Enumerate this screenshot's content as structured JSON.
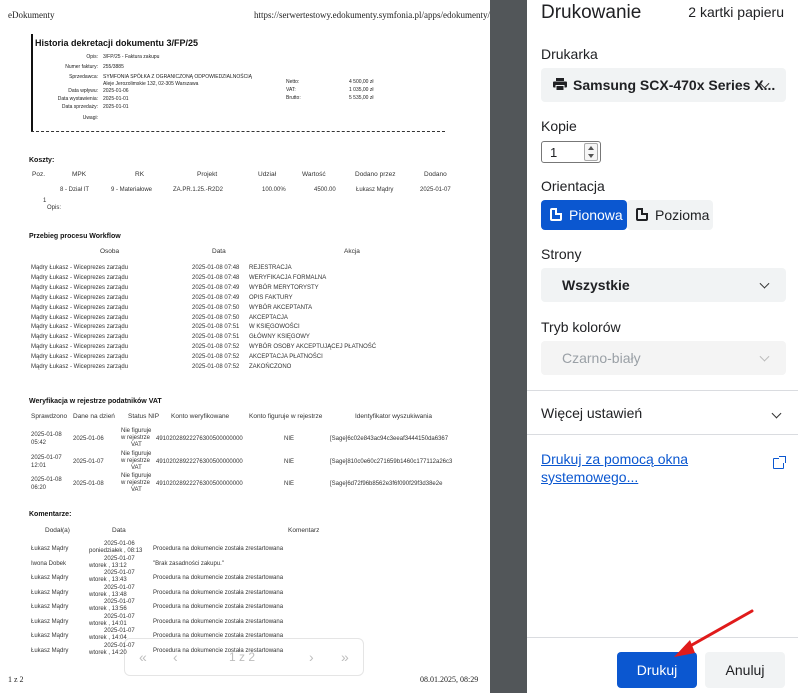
{
  "page_header": {
    "left": "eDokumenty",
    "right": "https://serwertestowy.edokumenty.symfonia.pl/apps/edokumenty/e..."
  },
  "page_footer": {
    "left": "1 z 2",
    "right": "08.01.2025, 08:29"
  },
  "document": {
    "title": "Historia dekretacji dokumentu 3/FP/25",
    "meta": [
      {
        "label": "Opis:",
        "value": "3/FP/25 - Faktura zakupu"
      },
      {
        "label": "Numer faktury:",
        "value": "255/3885"
      },
      {
        "label": "Sprzedawca:",
        "value": "SYMFONIA SPÓŁKA Z OGRANICZONĄ ODPOWIEDZIALNOŚCIĄ"
      },
      {
        "label": "",
        "value": "Aleje Jerozolimskie 132, 02-305 Warszawa"
      },
      {
        "label": "Data wpływu:",
        "value": "2025-01-06"
      },
      {
        "label": "Data wystawienia:",
        "value": "2025-01-01"
      },
      {
        "label": "Data sprzedaży:",
        "value": "2025-01-01"
      },
      {
        "label": "Uwagi:",
        "value": ""
      }
    ],
    "amounts": [
      {
        "label": "Netto:",
        "value": "4 500,00 zł"
      },
      {
        "label": "VAT:",
        "value": "1 035,00 zł"
      },
      {
        "label": "Brutto:",
        "value": "5 535,00 zł"
      }
    ],
    "koszty": {
      "title": "Koszty:",
      "headers": [
        "Poz.",
        "MPK",
        "RK",
        "Projekt",
        "Udział",
        "Wartość",
        "Dodano przez",
        "Dodano"
      ],
      "row": [
        "",
        "8 - Dział IT",
        "9 - Materiałowe",
        "ZA.PR.1.25.-R2D2",
        "100.00%",
        "4500.00",
        "Łukasz Mądry",
        "2025-01-07"
      ],
      "row_index": "1",
      "opis": "Opis:"
    },
    "workflow": {
      "title": "Przebieg procesu Workflow",
      "headers": [
        "Osoba",
        "Data",
        "Akcja"
      ],
      "rows": [
        [
          "Mądry Łukasz - Wiceprezes zarządu",
          "2025-01-08 07:48",
          "REJESTRACJA"
        ],
        [
          "Mądry Łukasz - Wiceprezes zarządu",
          "2025-01-08 07:48",
          "WERYFIKACJA FORMALNA"
        ],
        [
          "Mądry Łukasz - Wiceprezes zarządu",
          "2025-01-08 07:49",
          "WYBÓR MERYTORYSTY"
        ],
        [
          "Mądry Łukasz - Wiceprezes zarządu",
          "2025-01-08 07:49",
          "OPIS FAKTURY"
        ],
        [
          "Mądry Łukasz - Wiceprezes zarządu",
          "2025-01-08 07:50",
          "WYBÓR AKCEPTANTA"
        ],
        [
          "Mądry Łukasz - Wiceprezes zarządu",
          "2025-01-08 07:50",
          "AKCEPTACJA"
        ],
        [
          "Mądry Łukasz - Wiceprezes zarządu",
          "2025-01-08 07:51",
          "W KSIĘGOWOŚCI"
        ],
        [
          "Mądry Łukasz - Wiceprezes zarządu",
          "2025-01-08 07:51",
          "GŁÓWNY KSIĘGOWY"
        ],
        [
          "Mądry Łukasz - Wiceprezes zarządu",
          "2025-01-08 07:52",
          "WYBÓR OSOBY AKCEPTUJĄCEJ PŁATNOŚĆ"
        ],
        [
          "Mądry Łukasz - Wiceprezes zarządu",
          "2025-01-08 07:52",
          "AKCEPTACJA PŁATNOŚCI"
        ],
        [
          "Mądry Łukasz - Wiceprezes zarządu",
          "2025-01-08 07:52",
          "ZAKOŃCZONO"
        ]
      ]
    },
    "vat": {
      "title": "Weryfikacja w rejestrze podatników VAT",
      "headers": [
        "Sprawdzono",
        "Dane na dzień",
        "Status NIP",
        "Konto weryfikowane",
        "Konto figuruje w rejestrze",
        "Identyfikator wyszukiwania"
      ],
      "rows": [
        {
          "checked": [
            "2025-01-08",
            "05:42"
          ],
          "date": "2025-01-06",
          "status": [
            "Nie figuruje",
            "w rejestrze",
            "VAT"
          ],
          "account": "49102028922276300500000000",
          "in_register": "NIE",
          "id": "[Sage]6c02e843ac94c3eeaf3444150da6367"
        },
        {
          "checked": [
            "2025-01-07",
            "12:01"
          ],
          "date": "2025-01-07",
          "status": [
            "Nie figuruje",
            "w rejestrze",
            "VAT"
          ],
          "account": "49102028922276300500000000",
          "in_register": "NIE",
          "id": "[Sage]810c0e60c271659b1460c177112a26c3"
        },
        {
          "checked": [
            "2025-01-08",
            "06:20"
          ],
          "date": "2025-01-08",
          "status": [
            "Nie figuruje",
            "w rejestrze",
            "VAT"
          ],
          "account": "49102028922276300500000000",
          "in_register": "NIE",
          "id": "[Sage]6d72f96b8562e3f6f090f29f3d38e2e"
        }
      ]
    },
    "comments": {
      "title": "Komentarze:",
      "headers": [
        "Dodał(a)",
        "Data",
        "Komentarz"
      ],
      "rows": [
        {
          "who": "Łukasz Mądry",
          "date": [
            "2025-01-06",
            "poniedziałek , 08:13"
          ],
          "text": "Procedura na dokumencie została zrestartowana"
        },
        {
          "who": "Iwona Dobek",
          "date": [
            "2025-01-07",
            "wtorek , 13:12"
          ],
          "text": "\"Brak zasadności zakupu.\""
        },
        {
          "who": "Łukasz Mądry",
          "date": [
            "2025-01-07",
            "wtorek , 13:43"
          ],
          "text": "Procedura na dokumencie została zrestartowana"
        },
        {
          "who": "Łukasz Mądry",
          "date": [
            "2025-01-07",
            "wtorek , 13:48"
          ],
          "text": "Procedura na dokumencie została zrestartowana"
        },
        {
          "who": "Łukasz Mądry",
          "date": [
            "2025-01-07",
            "wtorek , 13:56"
          ],
          "text": "Procedura na dokumencie została zrestartowana"
        },
        {
          "who": "Łukasz Mądry",
          "date": [
            "2025-01-07",
            "wtorek , 14:01"
          ],
          "text": "Procedura na dokumencie została zrestartowana"
        },
        {
          "who": "Łukasz Mądry",
          "date": [
            "2025-01-07",
            "wtorek , 14:04"
          ],
          "text": "Procedura na dokumencie została zrestartowana"
        },
        {
          "who": "Łukasz Mądry",
          "date": [
            "2025-01-07",
            "wtorek , 14:20"
          ],
          "text": "Procedura na dokumencie została zrestartowana"
        }
      ]
    }
  },
  "pager": {
    "first": "«",
    "prev": "‹",
    "page": "1 z 2",
    "next": "›",
    "last": "»"
  },
  "panel": {
    "title": "Drukowanie",
    "sheet_count": "2 kartki papieru",
    "printer_label": "Drukarka",
    "printer_value": "Samsung SCX-470x Series X...",
    "copies_label": "Kopie",
    "copies_value": "1",
    "orientation_label": "Orientacja",
    "orientation_portrait": "Pionowa",
    "orientation_landscape": "Pozioma",
    "pages_label": "Strony",
    "pages_value": "Wszystkie",
    "color_label": "Tryb kolorów",
    "color_value": "Czarno-biały",
    "more_settings": "Więcej ustawień",
    "system_dialog_link": "Drukuj za pomocą okna systemowego...",
    "print_button": "Drukuj",
    "cancel_button": "Anuluj"
  },
  "colors": {
    "accent": "#0b57d0",
    "panel_bg": "#ffffff",
    "preview_bg": "#525659",
    "arrow": "#e01b1b"
  }
}
